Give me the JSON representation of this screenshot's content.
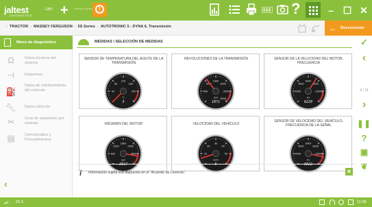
{
  "app": {
    "logo": "jaltest",
    "logo_sub": "DIAGNOSTICS",
    "gbp": "GBP",
    "remote_label": "Remote\ncontrol",
    "alert": "!"
  },
  "breadcrumb": {
    "items": [
      "TRACTOR",
      "MASSEY FERGUSON",
      "5S Series",
      "AUTOTRONIC 5 - DYNA 6, Transmisión"
    ],
    "disconnect_label": "Desconectar"
  },
  "sidebar": {
    "active_label": "Menú de diagnóstico",
    "items": [
      {
        "label": "Datos técnicos del sistema",
        "icon": "ohm-icon"
      },
      {
        "label": "Esquemas",
        "icon": "schematic-icon"
      },
      {
        "label": "Datos de mantenimiento del vehículo",
        "icon": "oil-can-icon"
      },
      {
        "label": "Datos vehículo",
        "icon": "wrench-icon"
      },
      {
        "label": "Guía de reparación por sistema",
        "icon": "tools-icon"
      },
      {
        "label": "Comunicados y Procedimientos",
        "icon": "documents-icon"
      }
    ]
  },
  "main": {
    "header": "MEDIDAS \\ SELECCIÓN DE MEDIDAS",
    "info_text": "Información sujeta a lo dispuesto en el \"Acuerdo de Licencia\".",
    "gauges": [
      {
        "title": "SENSOR DE TEMPERATURA DEL ACEITE DE LA TRANSMISIÓN",
        "unit": "°C",
        "value": "3",
        "ticks": [
          "40",
          "80",
          "120",
          "160",
          "200"
        ],
        "fraction": 0.0
      },
      {
        "title": "REVOLUCIONES DE LA TRANSMISIÓN",
        "unit": "rpm",
        "value": "1071",
        "ticks": [
          "500",
          "1000",
          "1500",
          "2000",
          "2500",
          "3000"
        ],
        "fraction": 0.36
      },
      {
        "title": "SENSOR DE LA VELOCIDAD DEL MOTOR, FRECUENCIA",
        "unit": "Hz",
        "value": "6229",
        "ticks": [
          "2000",
          "4000",
          "6000",
          "8000",
          "10000"
        ],
        "fraction": 0.62
      },
      {
        "title": "RÉGIMEN DEL MOTOR",
        "unit": "rpm",
        "value": "2617",
        "ticks": [
          "600",
          "1200",
          "1800",
          "2400",
          "3000"
        ],
        "fraction": 0.87
      },
      {
        "title": "VELOCIDAD DEL VEHÍCULO",
        "unit": "km/h",
        "value": "5",
        "ticks": [
          "10",
          "20",
          "30",
          "40",
          "50"
        ],
        "fraction": 0.1
      },
      {
        "title": "SENSOR DE VELOCIDAD DEL VEHÍCULO, FRECUENCIA DE LA SEÑAL",
        "unit": "Hz",
        "value": "8822",
        "ticks": [
          "2000",
          "4000",
          "6000",
          "8000",
          "10000"
        ],
        "fraction": 0.88
      }
    ]
  },
  "rightbar": {
    "pager": "4 / 11"
  },
  "status": {
    "voltage": "25.3",
    "time": "11:38"
  },
  "colors": {
    "accent": "#8bc03c",
    "orange": "#f39a1e",
    "needle": "#e53935"
  }
}
